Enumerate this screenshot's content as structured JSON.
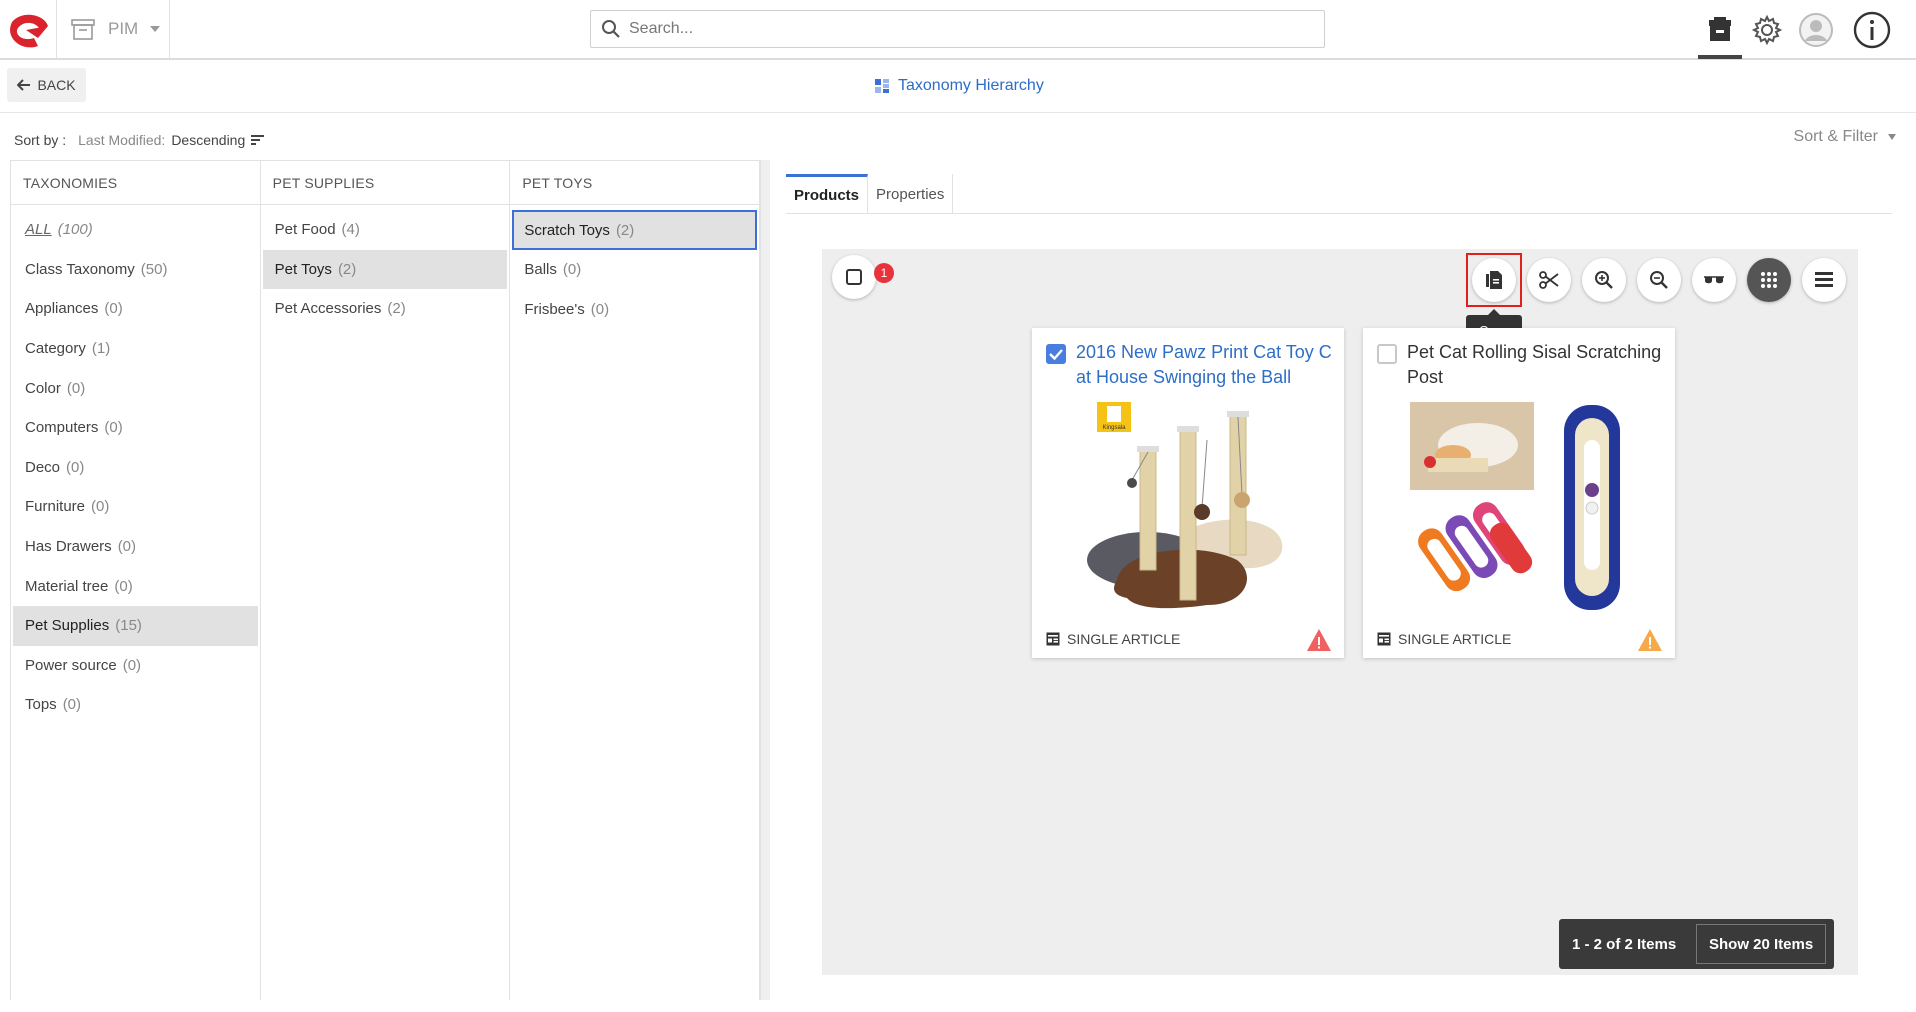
{
  "app": {
    "name": "PIM",
    "search_placeholder": "Search..."
  },
  "subheader": {
    "back_label": "BACK",
    "page_title": "Taxonomy Hierarchy"
  },
  "sort": {
    "label": "Sort by :",
    "field": "Last Modified:",
    "direction": "Descending",
    "filter_label": "Sort & Filter"
  },
  "columns": [
    {
      "header": "TAXONOMIES",
      "items": [
        {
          "label": "ALL",
          "count": "(100)"
        },
        {
          "label": "Class Taxonomy",
          "count": "(50)"
        },
        {
          "label": "Appliances",
          "count": "(0)"
        },
        {
          "label": "Category",
          "count": "(1)"
        },
        {
          "label": "Color",
          "count": "(0)"
        },
        {
          "label": "Computers",
          "count": "(0)"
        },
        {
          "label": "Deco",
          "count": "(0)"
        },
        {
          "label": "Furniture",
          "count": "(0)"
        },
        {
          "label": "Has Drawers",
          "count": "(0)"
        },
        {
          "label": "Material tree",
          "count": "(0)"
        },
        {
          "label": "Pet Supplies",
          "count": "(15)"
        },
        {
          "label": "Power source",
          "count": "(0)"
        },
        {
          "label": "Tops",
          "count": "(0)"
        }
      ]
    },
    {
      "header": "PET SUPPLIES",
      "items": [
        {
          "label": "Pet Food",
          "count": "(4)"
        },
        {
          "label": "Pet Toys",
          "count": "(2)"
        },
        {
          "label": "Pet Accessories",
          "count": "(2)"
        }
      ]
    },
    {
      "header": "PET TOYS",
      "items": [
        {
          "label": "Scratch Toys",
          "count": "(2)"
        },
        {
          "label": "Balls",
          "count": "(0)"
        },
        {
          "label": "Frisbee's",
          "count": "(0)"
        }
      ]
    }
  ],
  "tabs": [
    "Products",
    "Properties"
  ],
  "toolbar": {
    "selection_count": "1",
    "tooltip": "Copy"
  },
  "cards": [
    {
      "title": "2016 New Pawz Print Cat Toy Cat House Swinging the Ball",
      "type_label": "SINGLE ARTICLE",
      "brand": "Kingsala",
      "checked": true,
      "warning_color": "#f06060"
    },
    {
      "title": "Pet Cat Rolling Sisal Scratching Post",
      "type_label": "SINGLE ARTICLE",
      "checked": false,
      "warning_color": "#f6a84a"
    }
  ],
  "pagination": {
    "count": "1 - 2 of 2 Items",
    "show_label": "Show 20 Items"
  },
  "colors": {
    "accent": "#2d6ec8",
    "focus": "#3c6fd8",
    "badge": "#e8333a",
    "highlight": "#e02020"
  }
}
